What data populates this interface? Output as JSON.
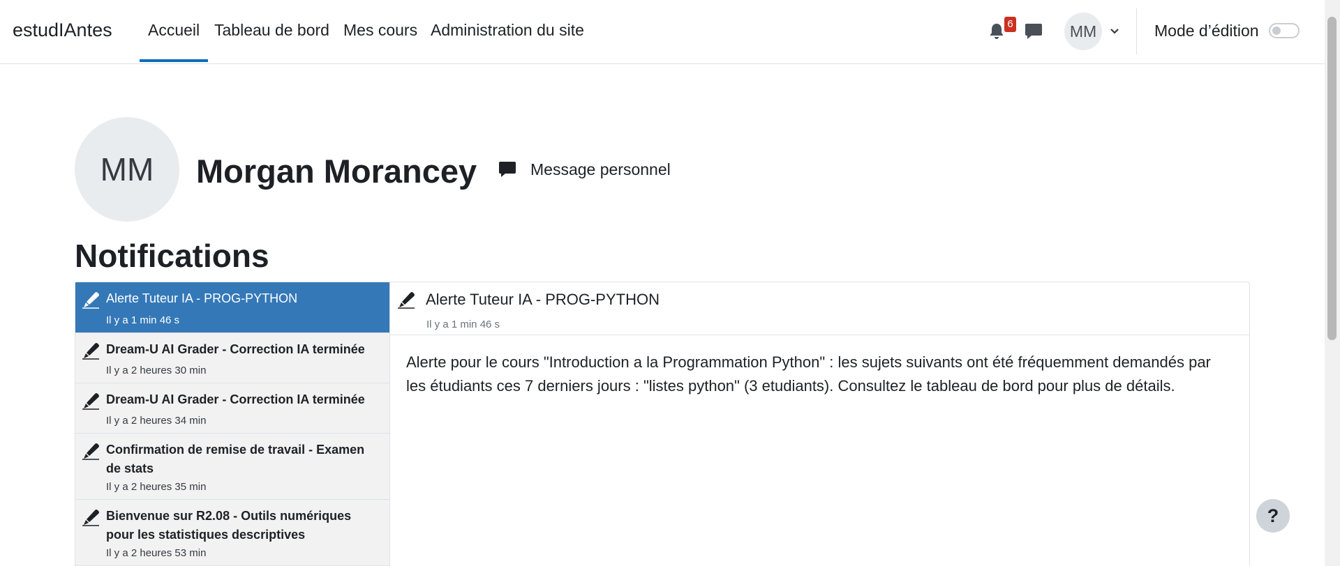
{
  "navbar": {
    "brand": "estudIAntes",
    "items": [
      {
        "label": "Accueil",
        "active": true
      },
      {
        "label": "Tableau de bord"
      },
      {
        "label": "Mes cours"
      },
      {
        "label": "Administration du site"
      }
    ],
    "notification_count": "6",
    "user_initials": "MM",
    "edit_mode_label": "Mode d’édition",
    "edit_mode_on": false
  },
  "profile": {
    "initials": "MM",
    "name": "Morgan Morancey",
    "message_label": "Message personnel"
  },
  "notifications": {
    "heading": "Notifications",
    "items": [
      {
        "title": "Alerte Tuteur IA - PROG-PYTHON",
        "time": "Il y a 1 min 46 s",
        "selected": true
      },
      {
        "title": "Dream-U AI Grader - Correction IA terminée",
        "time": "Il y a 2 heures 30 min"
      },
      {
        "title": "Dream-U AI Grader - Correction IA terminée",
        "time": "Il y a 2 heures 34 min"
      },
      {
        "title": "Confirmation de remise de travail - Examen de stats",
        "time": "Il y a 2 heures 35 min"
      },
      {
        "title": "Bienvenue sur R2.08 - Outils numériques pour les statistiques descriptives",
        "time": "Il y a 2 heures 53 min"
      }
    ],
    "detail": {
      "title": "Alerte Tuteur IA - PROG-PYTHON",
      "time": "Il y a 1 min 46 s",
      "body": "Alerte pour le cours \"Introduction a la Programmation Python\" : les sujets suivants ont été fréquemment demandés par les étudiants ces 7 derniers jours : \"listes python\" (3 etudiants). Consultez le tableau de bord pour plus de détails."
    }
  },
  "help_label": "?",
  "icons": {
    "bell": "bell-icon",
    "messages": "chat-bubble-icon",
    "dropdown": "chevron-down-icon",
    "notification": "pen-icon"
  },
  "colors": {
    "accent": "#0f6cbf",
    "selected_row": "#3478b8",
    "badge": "#ca3120"
  }
}
